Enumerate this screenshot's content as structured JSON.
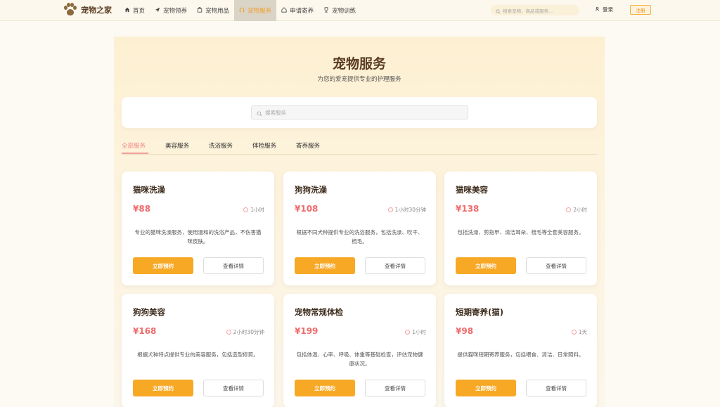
{
  "header": {
    "logo_text": "宠物之家",
    "nav": [
      {
        "label": "首页",
        "icon": "home-icon"
      },
      {
        "label": "宠物领养",
        "icon": "send-icon"
      },
      {
        "label": "宠物用品",
        "icon": "bag-icon"
      },
      {
        "label": "宠物服务",
        "icon": "headset-icon",
        "active": true
      },
      {
        "label": "申请寄养",
        "icon": "house-icon"
      },
      {
        "label": "宠物训练",
        "icon": "trophy-icon"
      }
    ],
    "search_placeholder": "搜索宠物、商品或服务...",
    "login_label": "登录",
    "register_label": "注册"
  },
  "main": {
    "title": "宠物服务",
    "subtitle": "为您的爱宠提供专业的护理服务",
    "search_placeholder": "搜索服务",
    "tabs": [
      {
        "label": "全部服务",
        "active": true
      },
      {
        "label": "美容服务"
      },
      {
        "label": "洗浴服务"
      },
      {
        "label": "体检服务"
      },
      {
        "label": "寄养服务"
      }
    ],
    "book_label": "立即预约",
    "detail_label": "查看详情",
    "services": [
      {
        "name": "猫咪洗澡",
        "price": "¥88",
        "duration": "1小时",
        "desc": "专业的猫咪洗澡服务，使用温和的洗浴产品，不伤害猫咪皮肤。"
      },
      {
        "name": "狗狗洗澡",
        "price": "¥108",
        "duration": "1小时30分钟",
        "desc": "根据不同犬种提供专业的洗浴服务，包括洗澡、吹干、梳毛。"
      },
      {
        "name": "猫咪美容",
        "price": "¥138",
        "duration": "2小时",
        "desc": "包括洗澡、剪指甲、清洁耳朵、梳毛等全套美容服务。"
      },
      {
        "name": "狗狗美容",
        "price": "¥168",
        "duration": "2小时30分钟",
        "desc": "根据犬种特点提供专业的美容服务，包括造型修剪。"
      },
      {
        "name": "宠物常规体检",
        "price": "¥199",
        "duration": "1小时",
        "desc": "包括体温、心率、呼吸、体重等基础检查，评估宠物健康状况。"
      },
      {
        "name": "短期寄养(猫)",
        "price": "¥98",
        "duration": "1天",
        "desc": "提供猫咪短期寄养服务，包括喂食、清洁、日常照料。"
      }
    ]
  },
  "colors": {
    "accent": "#f7a825",
    "price": "#ef6b6b",
    "active_tab": "#f28c8c"
  }
}
